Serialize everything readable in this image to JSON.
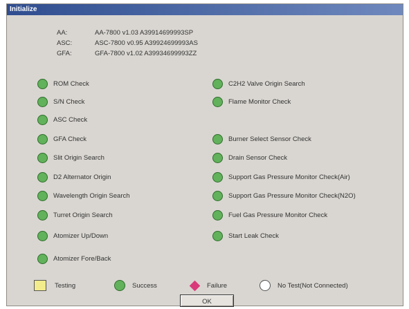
{
  "window": {
    "title": "Initialize"
  },
  "info": [
    {
      "label": "AA:",
      "value": "AA-7800 v1.03 A39914699993SP"
    },
    {
      "label": "ASC:",
      "value": "ASC-7800 v0.95 A39924699993AS"
    },
    {
      "label": "GFA:",
      "value": "GFA-7800 v1.02 A39934699993ZZ"
    }
  ],
  "checks_left": [
    {
      "label": "ROM Check",
      "status": "success"
    },
    {
      "label": "S/N Check",
      "status": "success"
    },
    {
      "label": "ASC Check",
      "status": "success"
    },
    {
      "label": "GFA Check",
      "status": "success"
    },
    {
      "label": "Slit Origin Search",
      "status": "success"
    },
    {
      "label": "D2 Alternator Origin",
      "status": "success"
    },
    {
      "label": "Wavelength Origin Search",
      "status": "success"
    },
    {
      "label": "Turret Origin Search",
      "status": "success"
    },
    {
      "label": "Atomizer Up/Down",
      "status": "success"
    },
    {
      "label": "Atomizer Fore/Back",
      "status": "success"
    }
  ],
  "checks_right": [
    {
      "label": "C2H2 Valve Origin Search",
      "status": "success"
    },
    {
      "label": "Flame Monitor Check",
      "status": "success"
    },
    {
      "label": "Burner Select Sensor Check",
      "status": "success"
    },
    {
      "label": "Drain Sensor Check",
      "status": "success"
    },
    {
      "label": "Support Gas Pressure Monitor Check(Air)",
      "status": "success"
    },
    {
      "label": "Support Gas Pressure Monitor Check(N2O)",
      "status": "success"
    },
    {
      "label": "Fuel Gas Pressure Monitor Check",
      "status": "success"
    },
    {
      "label": "Start Leak Check",
      "status": "success"
    }
  ],
  "legend": {
    "testing": "Testing",
    "success": "Success",
    "failure": "Failure",
    "no_test": "No Test(Not Connected)"
  },
  "ok_label": "OK",
  "colors": {
    "success": "#62b15b",
    "testing": "#f2ec8c",
    "failure": "#d93a7a",
    "no_test": "#ffffff"
  }
}
